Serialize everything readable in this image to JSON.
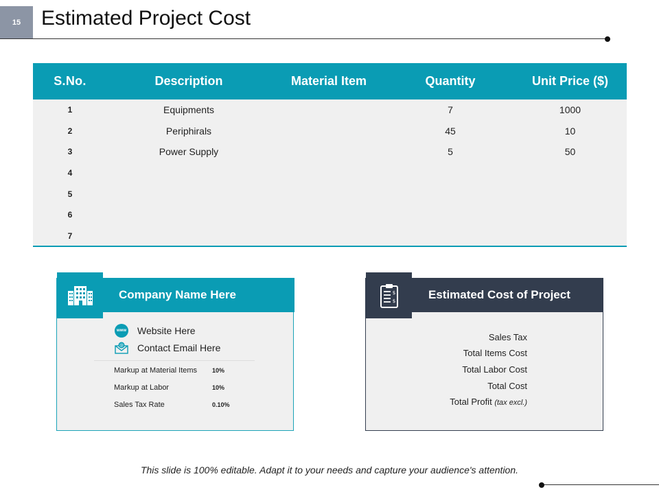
{
  "slide": {
    "number": "15",
    "title": "Estimated Project Cost"
  },
  "table": {
    "headers": [
      "S.No.",
      "Description",
      "Material Item",
      "Quantity",
      "Unit Price ($)"
    ],
    "rows": [
      [
        "1",
        "Equipments",
        "",
        "7",
        "1000"
      ],
      [
        "2",
        "Periphirals",
        "",
        "45",
        "10"
      ],
      [
        "3",
        "Power Supply",
        "",
        "5",
        "50"
      ],
      [
        "4",
        "",
        "",
        "",
        ""
      ],
      [
        "5",
        "",
        "",
        "",
        ""
      ],
      [
        "6",
        "",
        "",
        "",
        ""
      ],
      [
        "7",
        "",
        "",
        "",
        ""
      ]
    ]
  },
  "company": {
    "title": "Company Name Here",
    "icon": "building-icon",
    "website": "Website Here",
    "website_icon_text": "www",
    "email": "Contact Email Here",
    "markups": [
      {
        "label": "Markup at Material Items",
        "value": "10%"
      },
      {
        "label": "Markup at Labor",
        "value": "10%"
      },
      {
        "label": "Sales Tax Rate",
        "value": "0.10%"
      }
    ]
  },
  "estimate": {
    "title": "Estimated Cost of Project",
    "icon": "clipboard-dollar-icon",
    "items": [
      "Sales Tax",
      "Total Items Cost",
      "Total Labor Cost",
      "Total Cost"
    ],
    "profit_label": "Total Profit",
    "profit_note": "(tax excl.)"
  },
  "footer": "This slide is 100% editable. Adapt it to your needs and capture your audience's attention.",
  "colors": {
    "teal": "#0a9cb4",
    "navy": "#333d4e",
    "gray_badge": "#8c95a5",
    "panel_bg": "#f0f0f0"
  }
}
